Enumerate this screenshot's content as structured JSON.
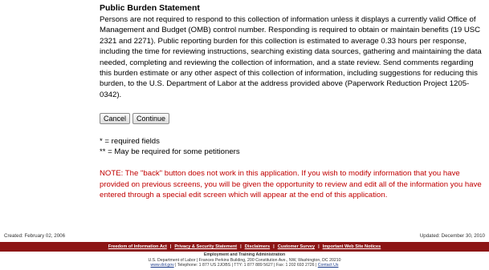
{
  "burden": {
    "title": "Public Burden Statement",
    "text": "Persons are not required to respond to this collection of information unless it displays a currently valid Office of Management and Budget (OMB) control number. Responding is required to obtain or maintain benefits (19 USC 2321 and 2271). Public reporting burden for this collection is estimated to average 0.33 hours per response, including the time for reviewing instructions, searching existing data sources, gathering and maintaining the data needed, completing and reviewing the collection of information, and a state review. Send comments regarding this burden estimate or any other aspect of this collection of information, including suggestions for reducing this burden, to the U.S. Department of Labor at the address provided above (Paperwork Reduction Project 1205-0342)."
  },
  "buttons": {
    "cancel": "Cancel",
    "continue": "Continue"
  },
  "legend": {
    "required": "* = required fields",
    "may_required": "** = May be required for some petitioners"
  },
  "note": "NOTE: The \"back\" button does not work in this application. If you wish to modify information that you have provided on previous screens, you will be given the opportunity to review and edit all of the information you have entered through a special edit screen which will appear at the end of this application.",
  "meta": {
    "created": "Created: February 02, 2006",
    "updated": "Updated: December 30, 2010"
  },
  "footer_links": {
    "foia": "Freedom of Information Act",
    "privacy": "Privacy & Security Statement",
    "disclaimers": "Disclaimers",
    "survey": "Customer Survey",
    "notices": "Important Web Site Notices",
    "separator": "|"
  },
  "footer_info": {
    "agency": "Employment and Training Administration",
    "address": "U.S. Department of Labor | Frances Perkins Building, 200 Constitution Ave., NW, Washington, DC 20210",
    "website": "www.dol.gov",
    "contact": " | Telephone: 1 877 US 2JOBS | TTY: 1 877 889 5627 | Fax: 1 202 693 2726 | ",
    "contact_us": "Contact Us"
  },
  "colors": {
    "footer_bar": "#8c1515",
    "note_text": "#c00000"
  }
}
